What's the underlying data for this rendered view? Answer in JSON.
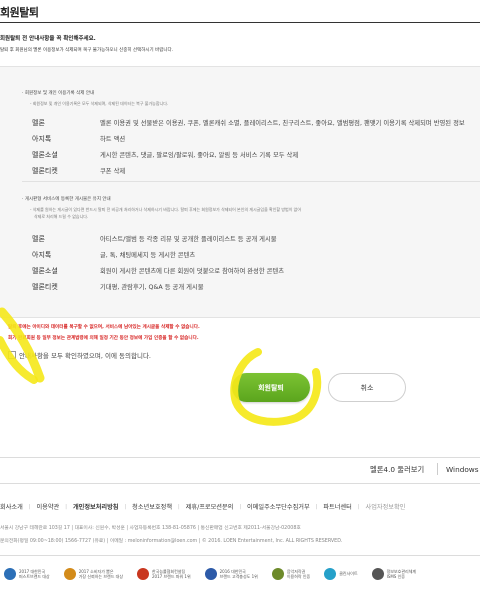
{
  "page": {
    "title": "회원탈퇴",
    "intro_line1": "회원탈퇴 전 안내사항을 꼭 확인해주세요.",
    "intro_line2": "탈퇴 후 회원님의 멜론 이용정보가 삭제되며 복구 불가능하오니 신중히 선택하시기 바랍니다."
  },
  "info": {
    "section1": {
      "title": "· 회원정보 및 개인 이용기록 삭제 안내",
      "subtitle": "- 회원정보 및 개인 이용기록은 모두 삭제되며, 삭제된 데이터는 복구 불가능합니다.",
      "rows": [
        {
          "label": "멜론",
          "value": "멜론 이용권 및 선물받은 이용권, 쿠폰, 멜론캐쉬 소멸, 플레이리스트, 친구리스트, 좋아요, 앨범평점, 팬맺기 이용기록 삭제되며 반영된 정보"
        },
        {
          "label": "아지톡",
          "value": "하트 액션"
        },
        {
          "label": "멜론소셜",
          "value": "게시한 콘텐츠, 댓글, 팔로잉/팔로워, 좋아요, 알림 등 서비스 기록 모두 삭제"
        },
        {
          "label": "멜론티켓",
          "value": "쿠폰 삭제"
        }
      ]
    },
    "section2": {
      "title": "· 게시판형 서비스에 등록한 게시물은 유지 안내",
      "subtitle1": "- 삭제를 원하는 게시글이 있다면 반드시 탈퇴 전 비공개 처리하거나 삭제하시기 바랍니다. 탈퇴 후에는 회원정보가 삭제되어 본인의 게시글임을 확인할 방법이 없어",
      "subtitle2": "삭제로 처리해 드릴 수 없습니다.",
      "rows": [
        {
          "label": "멜론",
          "value": "아티스트/앨범 등 각종 리뷰 및 공개한 플레이리스트 등 공개 게시물"
        },
        {
          "label": "아지톡",
          "value": "글, 톡, 채팅메세지 등 게시한 콘텐츠"
        },
        {
          "label": "멜론소셜",
          "value": "회원이 게시한 콘텐츠에 다른 회원이 덧붙으로 참여하여 완성한 콘텐츠"
        },
        {
          "label": "멜론티켓",
          "value": "기대평, 관람후기, Q&A 등 공개 게시물"
        }
      ]
    }
  },
  "warnings": {
    "line1": "탈퇴 후에는 아이디와 데이터를 복구할 수 없으며, 서비스에 남아있는 게시글을 삭제할 수 없습니다.",
    "line2": "회기 완료회원 등 일부 정보는 관계법령에 의해 일정 기간 동안 정보에 가입 인증을 할 수 없습니다."
  },
  "agree": {
    "label": "안내사항을 모두 확인하였으며, 이에 동의합니다."
  },
  "buttons": {
    "withdraw": "회원탈퇴",
    "cancel": "취소"
  },
  "footer": {
    "view_toggle": {
      "melon40": "멜론4.0 둘러보기",
      "windows": "Windows"
    },
    "links": [
      "회사소개",
      "이용약관",
      "개인정보처리방침",
      "청소년보호정책",
      "제휴/프로모션문의",
      "이메일주소무단수집거부",
      "파트너센터",
      "사업자정보확인"
    ],
    "address_line1": "서울시 강남구 테헤란로 103길 17  |  대표이사: 신원수, 박성훈  |  사업자등록번호 138-81-05876  |  통신판매업 신고번호 제2011-서울강남-02008호",
    "address_line2": "문의전화(평일 09:00~18:00) 1566-7727 (유료)  |  이메일 : meloninformation@loen.com  |  © 2016. LOEN Entertainment, Inc. ALL RIGHTS RESERVED.",
    "awards": [
      {
        "line1": "2017 대한민국",
        "line2": "퍼스트브랜드 대상",
        "color": "#2c6fb7"
      },
      {
        "line1": "2017 소비자가 뽑은",
        "line2": "가장 신뢰하는 브랜드 대상",
        "color": "#d38b1a"
      },
      {
        "line1": "한국능률협회컨설팅",
        "line2": "2017 브랜드 파워 1위",
        "color": "#c9371f"
      },
      {
        "line1": "2016 대한민국",
        "line2": "브랜드 고객충성도 1위",
        "color": "#2d5aa8"
      },
      {
        "line1": "음악저작권",
        "line2": "이용허락 인증",
        "color": "#6d8a2a"
      },
      {
        "line1": "클린사이트",
        "line2": "",
        "color": "#25a0c9"
      },
      {
        "line1": "정보보호관리체계",
        "line2": "ISMS 인증",
        "color": "#555555"
      }
    ]
  },
  "colors": {
    "accent_green": "#6bb52a",
    "warning_red": "#d6201f",
    "highlight_yellow": "#f5e81a"
  }
}
